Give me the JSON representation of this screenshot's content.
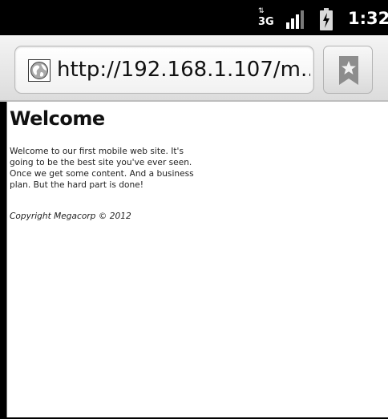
{
  "status_bar": {
    "network_label": "3G",
    "time": "1:32",
    "icons": {
      "network": "network-3g-icon",
      "signal": "signal-strength-icon",
      "battery": "battery-charging-icon"
    }
  },
  "browser": {
    "url": "http://192.168.1.107/m...",
    "icons": {
      "site": "globe-icon",
      "bookmark": "bookmark-star-icon"
    }
  },
  "page": {
    "title": "Welcome",
    "body": "Welcome to our first mobile web site. It's going to be the best site you've ever seen. Once we get some content. And a business plan. But the hard part is done!",
    "footer": "Copyright Megacorp © 2012"
  },
  "colors": {
    "status_bar_bg": "#000000",
    "toolbar_bg": "#e6e6e6",
    "page_bg": "#ffffff",
    "text": "#222222"
  }
}
